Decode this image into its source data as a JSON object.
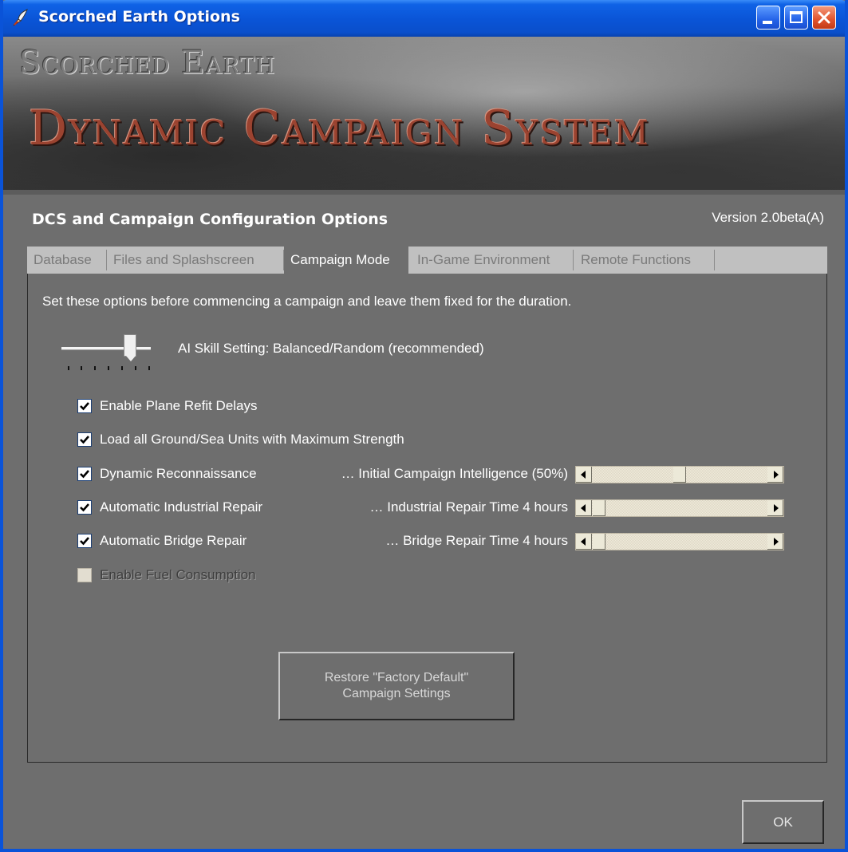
{
  "window": {
    "title": "Scorched Earth Options",
    "icon": "flame-pen-icon",
    "controls": [
      "minimize",
      "maximize",
      "close"
    ]
  },
  "banner": {
    "line1": "Scorched Earth",
    "line2": "Dynamic Campaign System"
  },
  "header": {
    "title": "DCS and Campaign Configuration Options",
    "version": "Version 2.0beta(A)"
  },
  "tabs": [
    {
      "label": "Database",
      "active": false
    },
    {
      "label": "Files and Splashscreen",
      "active": false
    },
    {
      "label": "Campaign Mode",
      "active": true
    },
    {
      "label": "In-Game Environment",
      "active": false
    },
    {
      "label": "Remote Functions",
      "active": false
    }
  ],
  "campaign": {
    "intro": "Set these options before commencing a campaign and leave them fixed for the duration.",
    "ai_skill": {
      "label": "AI Skill Setting: Balanced/Random (recommended)",
      "tick_count": 7,
      "position_index": 5
    },
    "options": [
      {
        "label": "Enable Plane Refit Delays",
        "checked": true,
        "enabled": true
      },
      {
        "label": "Load all Ground/Sea Units with Maximum Strength",
        "checked": true,
        "enabled": true
      },
      {
        "label": "Dynamic Reconnaissance",
        "checked": true,
        "enabled": true
      },
      {
        "label": "Automatic Industrial Repair",
        "checked": true,
        "enabled": true
      },
      {
        "label": "Automatic Bridge Repair",
        "checked": true,
        "enabled": true
      },
      {
        "label": "Enable Fuel Consumption",
        "checked": false,
        "enabled": false
      }
    ],
    "sliders": [
      {
        "label": "… Initial Campaign Intelligence (50%)",
        "value_fraction": 0.5
      },
      {
        "label": "… Industrial Repair Time 4 hours",
        "value_fraction": 0.0
      },
      {
        "label": "… Bridge Repair Time 4 hours",
        "value_fraction": 0.0
      }
    ],
    "restore_button": "Restore \"Factory Default\"\nCampaign Settings"
  },
  "footer": {
    "ok_label": "OK"
  },
  "colors": {
    "titlebar": "#0a54d6",
    "panel": "#6e6e6e",
    "tabbar": "#c0c0c0",
    "banner_text": "#9b4330"
  }
}
